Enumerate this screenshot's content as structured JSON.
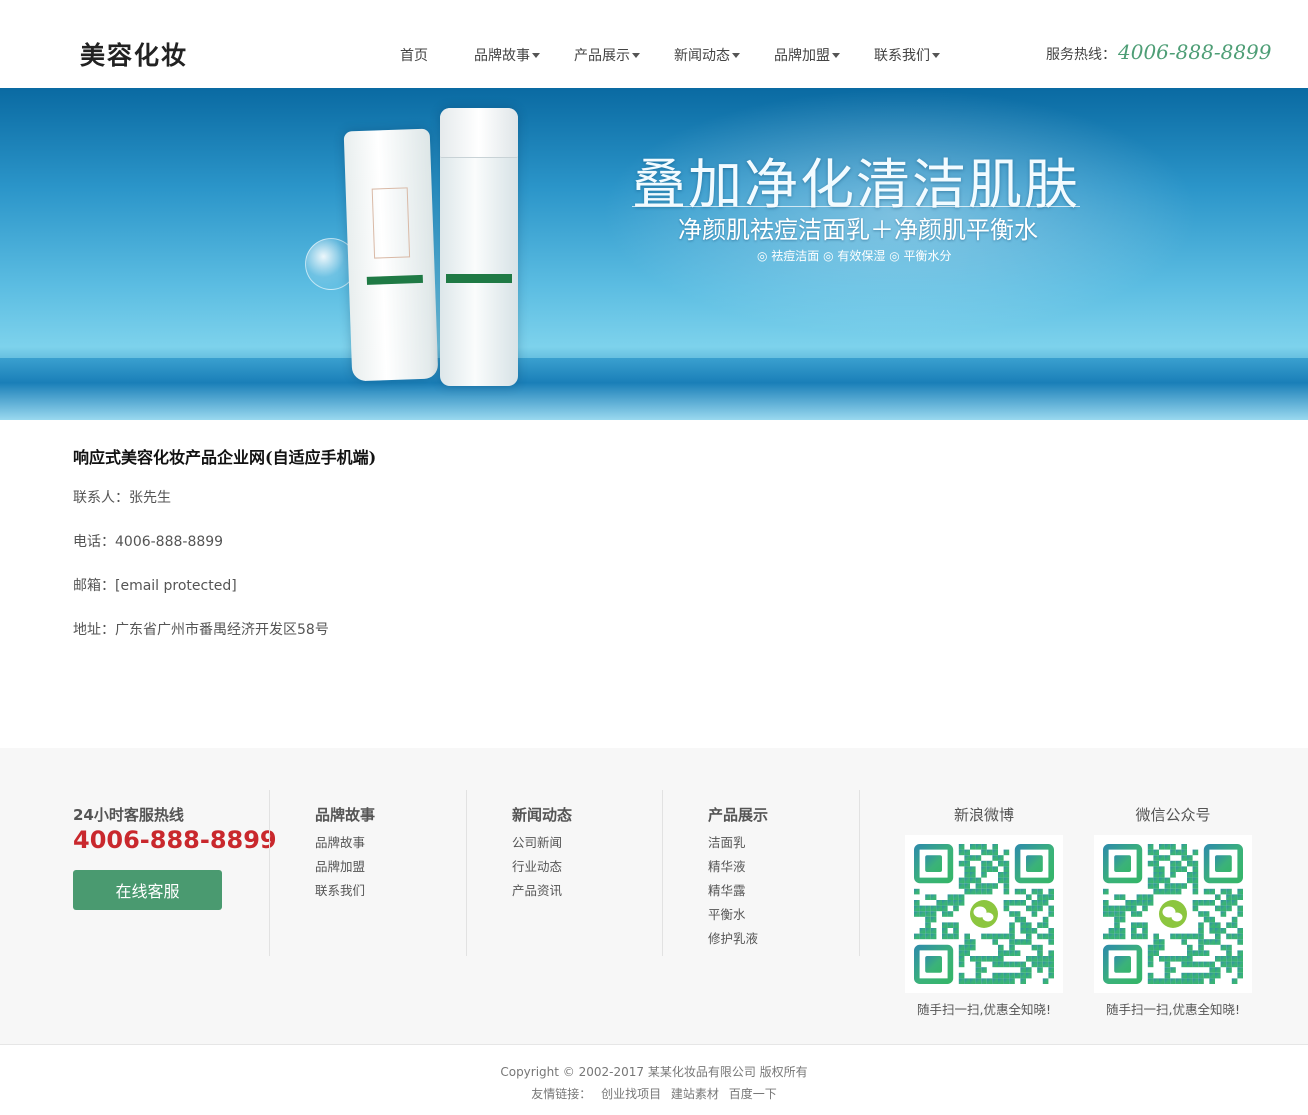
{
  "header": {
    "logo": "美容化妆",
    "nav": [
      {
        "label": "首页",
        "dropdown": false
      },
      {
        "label": "品牌故事",
        "dropdown": true
      },
      {
        "label": "产品展示",
        "dropdown": true
      },
      {
        "label": "新闻动态",
        "dropdown": true
      },
      {
        "label": "品牌加盟",
        "dropdown": true
      },
      {
        "label": "联系我们",
        "dropdown": true
      }
    ],
    "hotline_label": "服务热线：",
    "hotline_number": "4006-888-8899"
  },
  "banner": {
    "title": "叠加净化清洁肌肤",
    "subtitle": "净颜肌祛痘洁面乳＋净颜肌平衡水",
    "tags": "◎ 祛痘洁面 ◎ 有效保湿 ◎ 平衡水分"
  },
  "content": {
    "title": "响应式美容化妆产品企业网(自适应手机端)",
    "contact": "联系人：张先生",
    "phone": "电话：4006-888-8899",
    "email": "邮箱：[email protected]",
    "address": "地址：广东省广州市番禺经济开发区58号"
  },
  "footer": {
    "hotline_label": "24小时客服热线",
    "hotline_number": "4006-888-8899",
    "service_button": "在线客服",
    "columns": [
      {
        "title": "品牌故事",
        "links": [
          "品牌故事",
          "品牌加盟",
          "联系我们"
        ]
      },
      {
        "title": "新闻动态",
        "links": [
          "公司新闻",
          "行业动态",
          "产品资讯"
        ]
      },
      {
        "title": "产品展示",
        "links": [
          "洁面乳",
          "精华液",
          "精华露",
          "平衡水",
          "修护乳液"
        ]
      }
    ],
    "qr": [
      {
        "title": "新浪微博",
        "caption": "随手扫一扫,优惠全知晓!"
      },
      {
        "title": "微信公众号",
        "caption": "随手扫一扫,优惠全知晓!"
      }
    ],
    "copyright": "Copyright © 2002-2017 某某化妆品有限公司 版权所有",
    "friend_label": "友情链接：",
    "friend_links": [
      "创业找项目",
      "建站素材",
      "百度一下"
    ]
  },
  "colors": {
    "accent_green": "#4a9a70",
    "hotline_red": "#c9282d"
  }
}
